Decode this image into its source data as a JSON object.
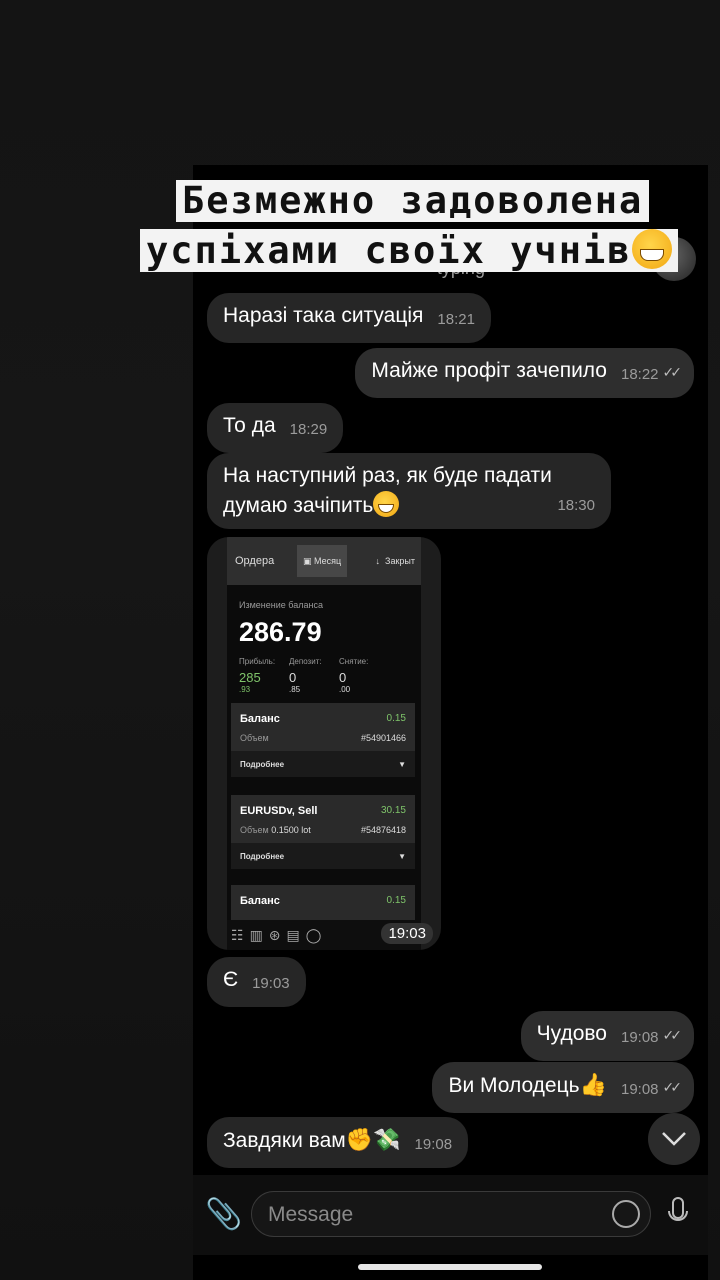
{
  "caption": {
    "line1": "Безмежно задоволена",
    "line2": "успіхами своїх учнів",
    "emoji": "grinning-face"
  },
  "header": {
    "status": "typing"
  },
  "messages": [
    {
      "dir": "in",
      "text": "Наразі така ситуація",
      "time": "18:21"
    },
    {
      "dir": "out",
      "text": "Майже профіт зачепило",
      "time": "18:22",
      "read": true
    },
    {
      "dir": "in",
      "text": "То да",
      "time": "18:29"
    },
    {
      "dir": "in",
      "text_line1": "На наступний раз, як буде падати",
      "text_line2": "думаю зачіпить",
      "emoji": "grinning-face",
      "time": "18:30"
    },
    {
      "dir": "in",
      "type": "image",
      "time": "19:03"
    },
    {
      "dir": "in",
      "text": "Є",
      "time": "19:03"
    },
    {
      "dir": "out",
      "text": "Чудово",
      "time": "19:08",
      "read": true
    },
    {
      "dir": "out",
      "text": "Ви Молодець",
      "emoji": "thumbs-up",
      "time": "19:08",
      "read": true
    },
    {
      "dir": "in",
      "text": "Завдяки вам",
      "emoji": "raised-fist money-with-wings",
      "time": "19:08"
    }
  ],
  "trade_screenshot": {
    "tab_orders": "Ордера",
    "tab_month": "Месяц",
    "tab_close": "Закрыт",
    "balance_change_label": "Изменение баланса",
    "balance_change_value": "286.79",
    "profit_label": "Прибыль:",
    "profit_value": "285",
    "profit_cents": ".93",
    "deposit_label": "Депозит:",
    "deposit_value": "0",
    "deposit_cents": ".85",
    "withdraw_label": "Снятие:",
    "withdraw_value": "0",
    "withdraw_cents": ".00",
    "cards": [
      {
        "title": "Баланс",
        "amount": "0.15",
        "sub_label": "Объем",
        "sub_value": "",
        "id": "#54901466",
        "more": "Подробнее"
      },
      {
        "title": "EURUSDv, Sell",
        "amount": "30.15",
        "sub_label": "Объем",
        "sub_value": "0.1500 lot",
        "id": "#54876418",
        "more": "Подробнее"
      },
      {
        "title": "Баланс",
        "amount": "0.15"
      }
    ]
  },
  "input": {
    "placeholder": "Message"
  },
  "colors": {
    "positive": "#7fc46a",
    "bubble": "#262626",
    "caption_bg": "#f3f3f3"
  }
}
